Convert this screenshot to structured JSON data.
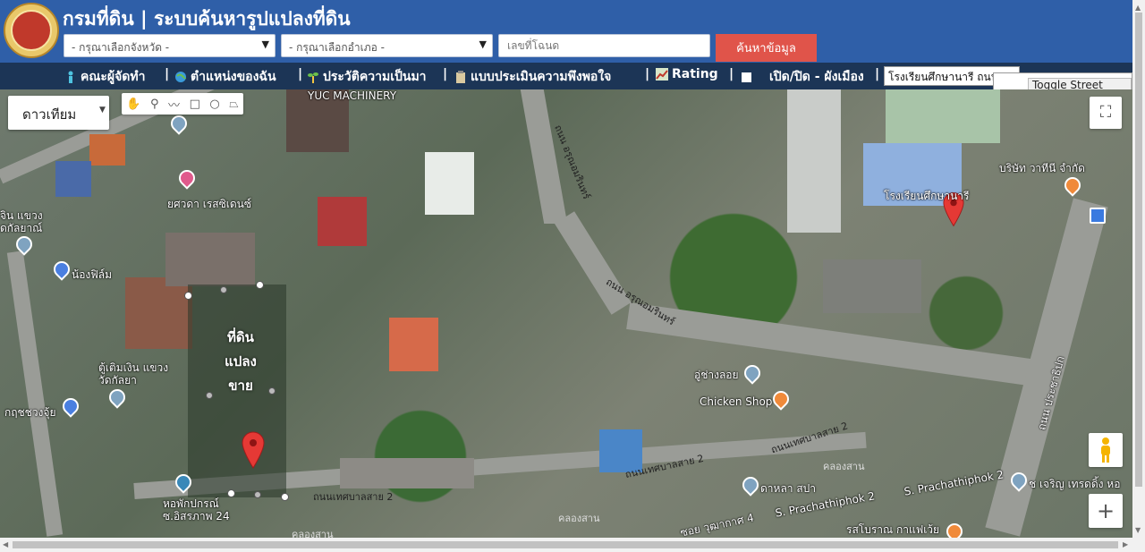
{
  "header": {
    "title": "กรมที่ดิน | ระบบค้นหารูปแปลงที่ดิน",
    "province_select": "- กรุณาเลือกจังหวัด -",
    "district_select": "- กรุณาเลือกอำเภอ -",
    "deed_placeholder": "เลขที่โฉนด",
    "search_button": "ค้นหาข้อมูล"
  },
  "nav": {
    "items": [
      {
        "label": "คณะผู้จัดทำ",
        "icon": "person-icon"
      },
      {
        "label": "ตำแหน่งของฉัน",
        "icon": "globe-icon"
      },
      {
        "label": "ประวัติความเป็นมา",
        "icon": "plant-icon"
      },
      {
        "label": "แบบประเมินความพึงพอใจ",
        "icon": "clipboard-icon"
      },
      {
        "label": "Rating",
        "icon": "chart-icon"
      },
      {
        "label": "เปิด/ปิด - ผังเมือง",
        "icon": "checkbox-icon"
      }
    ],
    "place_search_value": "โรงเรียนศึกษานารี ถนน ประชาธิปก"
  },
  "map": {
    "maptype_label": "ดาวเทียม",
    "street_view_toggle": "Toggle Street View",
    "land_label_lines": [
      "ที่ดิน",
      "แปลง",
      "ขาย"
    ],
    "labels": {
      "yuc": "YUC MACHINERY",
      "residence": "ยศวดา เรสซิเดนซ์",
      "nongfilm": "น้องฟิล์ม",
      "bank_branch": "ตู้เติมเงิน แขวง วัดกัลยา",
      "bank_left": "จิน แขวง ดกัลยาณ์",
      "kruthai": "กฤชชวงจุ้ย",
      "dorm": "หอพักปกรณ์ ซ.อิสรภาพ 24",
      "road_thesaban_left": "ถนนเทศบาลสาย 2",
      "road_thesaban_mid": "ถนนเทศบาลสาย 2",
      "road_thesaban_right": "ถนนเทศบาลสาย 2",
      "road_arun_top": "ถนน อรุณอมรินทร์",
      "road_arun_mid": "ถนน อรุณอมรินทร์",
      "school": "โรงเรียนศึกษานารี",
      "company": "บริษัท วาทีนี จำกัด",
      "garage": "อู่ช่างลอย",
      "chicken": "Chicken Shop",
      "dahla": "ดาหลา สปา",
      "prachathiphok_a": "S. Prachathiphok 2",
      "prachathiphok_b": "S. Prachathiphok 2",
      "road_prachathipok": "ถนน ประชาธิปก",
      "charoen": "ช เจริญ เทรดดิ้ง หอ",
      "soi_wutakat": "ซอย วุฒากาศ 4",
      "rosboran": "รสโบราณ กาแฟเว้ย",
      "klong_san_a": "คลองสาน",
      "klong_san_b": "คลองสาน",
      "klong_san_c": "คลองสาน"
    }
  }
}
